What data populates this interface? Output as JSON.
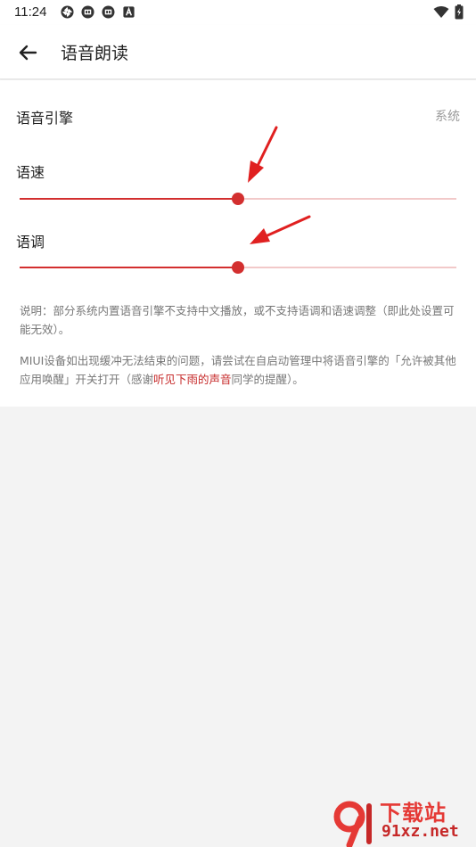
{
  "status_bar": {
    "time": "11:24",
    "left_icons": [
      "aperture-icon",
      "app-notification-icon",
      "app-notification-icon",
      "a-text-icon"
    ],
    "right_icons": [
      "wifi-icon",
      "battery-charging-icon"
    ]
  },
  "app_bar": {
    "back_icon": "arrow-left-icon",
    "title": "语音朗读"
  },
  "settings": {
    "engine": {
      "label": "语音引擎",
      "value": "系统"
    },
    "speed": {
      "label": "语速",
      "value_fraction": 0.5
    },
    "pitch": {
      "label": "语调",
      "value_fraction": 0.5
    }
  },
  "notes": {
    "note1": "说明：部分系统内置语音引擎不支持中文播放，或不支持语调和语速调整（即此处设置可能无效）。",
    "note2_before": "MIUI设备如出现缓冲无法结束的问题，请尝试在自启动管理中将语音引擎的「允许被其他应用唤醒」开关打开（感谢",
    "note2_highlight": "听见下雨的声音",
    "note2_after": "同学的提醒）。"
  },
  "watermark": {
    "top": "下载站",
    "bottom": "91xz.net"
  },
  "colors": {
    "accent": "#d32f2f",
    "track_inactive": "#f2c9c9",
    "annotation_arrow": "#e02020",
    "background": "#f3f3f3"
  }
}
